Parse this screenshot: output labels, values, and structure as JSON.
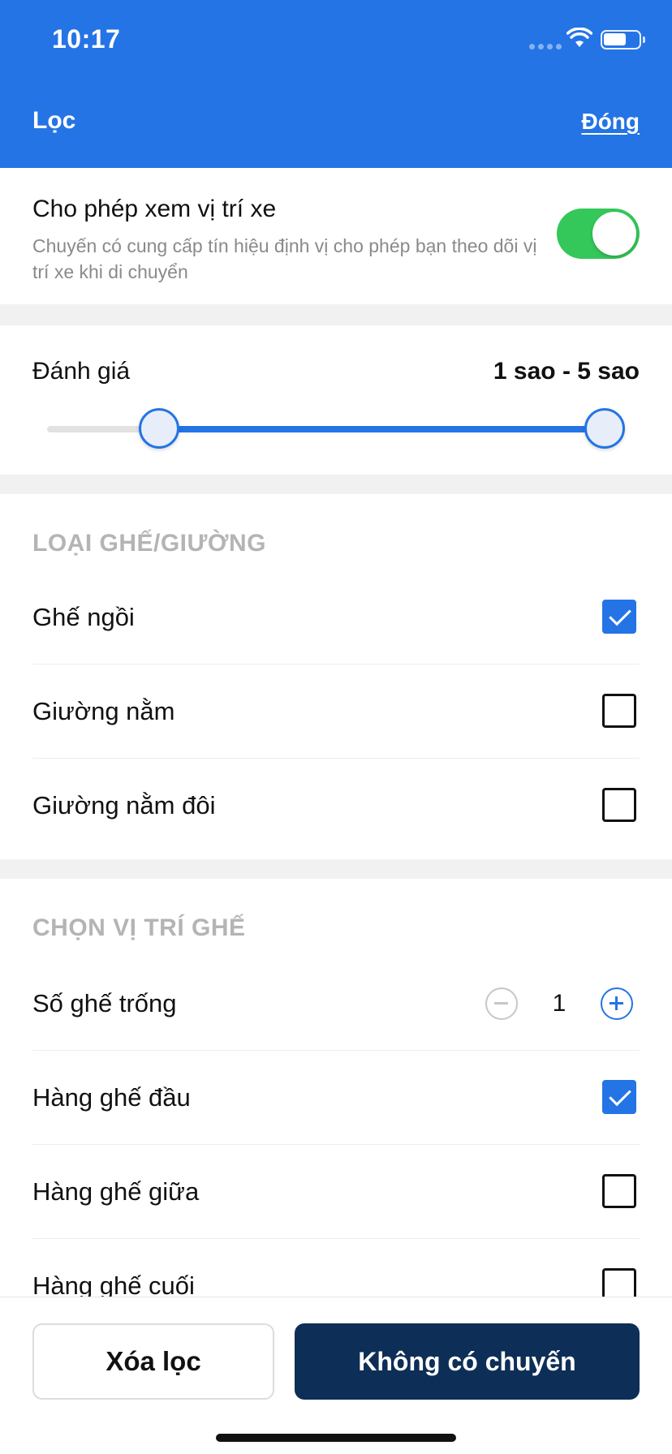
{
  "status_bar": {
    "time": "10:17"
  },
  "header": {
    "title": "Lọc",
    "close_label": "Đóng"
  },
  "location": {
    "title": "Cho phép xem vị trí xe",
    "description": "Chuyến có cung cấp tín hiệu định vị cho phép bạn theo dõi vị trí xe khi di chuyển",
    "enabled": true
  },
  "rating": {
    "label": "Đánh giá",
    "value_text": "1 sao - 5 sao",
    "min": 1,
    "max": 5,
    "selected_min": 1,
    "selected_max": 5
  },
  "seat_type": {
    "heading": "LOẠI GHẾ/GIƯỜNG",
    "options": [
      {
        "label": "Ghế ngồi",
        "checked": true
      },
      {
        "label": "Giường nằm",
        "checked": false
      },
      {
        "label": "Giường nằm đôi",
        "checked": false
      }
    ]
  },
  "seat_position": {
    "heading": "CHỌN VỊ TRÍ GHẾ",
    "empty_seats": {
      "label": "Số ghế trống",
      "value": "1"
    },
    "options": [
      {
        "label": "Hàng ghế đầu",
        "checked": true
      },
      {
        "label": "Hàng ghế giữa",
        "checked": false
      },
      {
        "label": "Hàng ghế cuối",
        "checked": false
      }
    ]
  },
  "footer": {
    "clear_label": "Xóa lọc",
    "apply_label": "Không có chuyến"
  },
  "colors": {
    "primary": "#2474e5",
    "toggle_on": "#34c759",
    "apply_button": "#0d2e56"
  }
}
